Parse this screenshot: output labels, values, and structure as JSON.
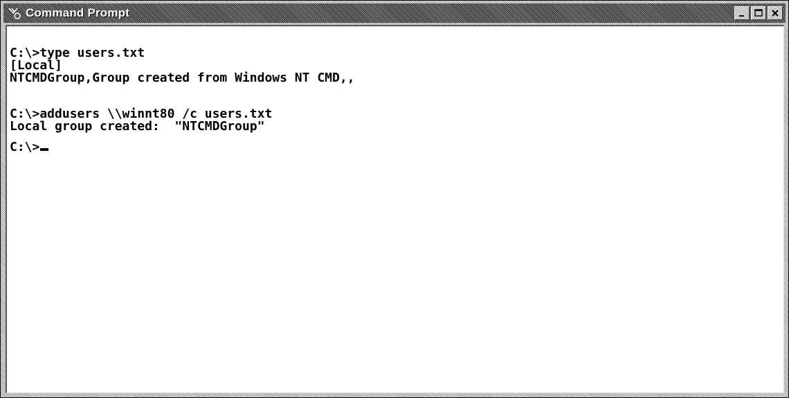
{
  "window": {
    "title": "Command Prompt",
    "icon": "ms-dos-icon",
    "buttons": [
      "minimize-icon",
      "maximize-icon",
      "close-icon"
    ]
  },
  "console": {
    "lines": [
      "C:\\>type users.txt",
      "[Local]",
      "NTCMDGroup,Group created from Windows NT CMD,,",
      "C:\\>addusers \\\\winnt80 /c users.txt",
      "Local group created:  \"NTCMDGroup\"",
      "C:\\>"
    ]
  },
  "colors": {
    "background": "#ffffff",
    "text": "#000000",
    "titlebar": "#5a5a5a"
  }
}
